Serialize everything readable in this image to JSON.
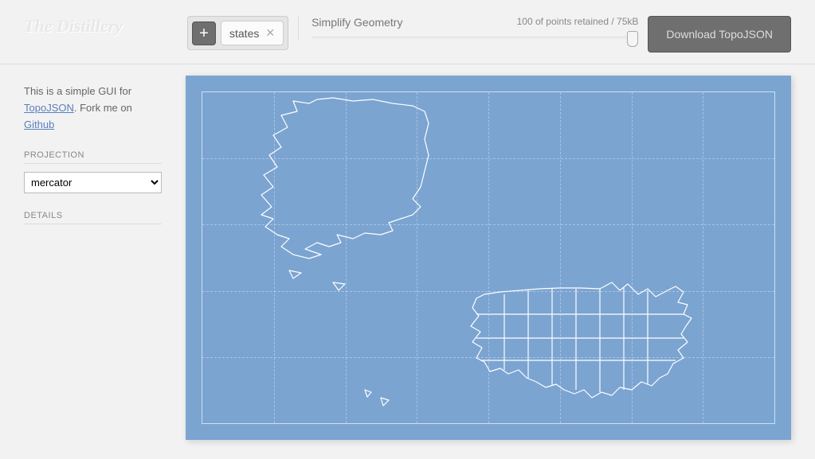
{
  "title": "The Distillery",
  "tags": [
    "states"
  ],
  "simplify": {
    "label": "Simplify Geometry",
    "status": "100 of points retained / 75kB"
  },
  "download": {
    "label": "Download TopoJSON"
  },
  "sidebar": {
    "intro_prefix": "This is a simple GUI for ",
    "link1": "TopoJSON",
    "intro_mid": ". Fork me on ",
    "link2": "Github",
    "projection_heading": "PROJECTION",
    "projection_value": "mercator",
    "details_heading": "DETAILS"
  }
}
